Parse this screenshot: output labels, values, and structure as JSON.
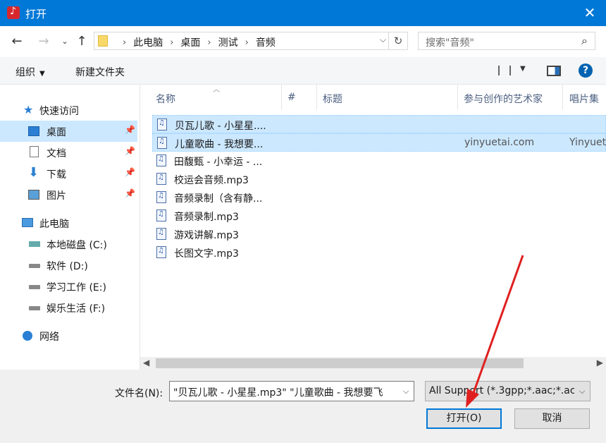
{
  "window": {
    "title": "打开"
  },
  "nav": {
    "breadcrumbs": [
      "此电脑",
      "桌面",
      "测试",
      "音频"
    ],
    "search_placeholder": "搜索\"音频\""
  },
  "toolbar": {
    "organize": "组织",
    "new_folder": "新建文件夹"
  },
  "sidebar": {
    "quick_access": "快速访问",
    "items": [
      {
        "label": "桌面",
        "icon": "desktop-icon"
      },
      {
        "label": "文档",
        "icon": "document-icon"
      },
      {
        "label": "下载",
        "icon": "download-icon"
      },
      {
        "label": "图片",
        "icon": "picture-icon"
      }
    ],
    "this_pc": "此电脑",
    "drives": [
      {
        "label": "本地磁盘 (C:)"
      },
      {
        "label": "软件 (D:)"
      },
      {
        "label": "学习工作 (E:)"
      },
      {
        "label": "娱乐生活 (F:)"
      }
    ],
    "network": "网络"
  },
  "columns": [
    "名称",
    "#",
    "标题",
    "参与创作的艺术家",
    "唱片集"
  ],
  "files": [
    {
      "name": "贝瓦儿歌 - 小星星....",
      "artist": "",
      "album": "",
      "selected": true
    },
    {
      "name": "儿童歌曲 - 我想要...",
      "artist": "yinyuetai.com",
      "album": "Yinyuet",
      "selected": true
    },
    {
      "name": "田馥甄 - 小幸运 - ...",
      "artist": "",
      "album": "",
      "selected": false
    },
    {
      "name": "校运会音频.mp3",
      "artist": "",
      "album": "",
      "selected": false
    },
    {
      "name": "音频录制（含有静...",
      "artist": "",
      "album": "",
      "selected": false
    },
    {
      "name": "音频录制.mp3",
      "artist": "",
      "album": "",
      "selected": false
    },
    {
      "name": "游戏讲解.mp3",
      "artist": "",
      "album": "",
      "selected": false
    },
    {
      "name": "长图文字.mp3",
      "artist": "",
      "album": "",
      "selected": false
    }
  ],
  "footer": {
    "filename_label": "文件名(N):",
    "filename_value": "\"贝瓦儿歌 - 小星星.mp3\" \"儿童歌曲 - 我想要飞",
    "filetype_value": "All Support (*.3gpp;*.aac;*.ac",
    "open_label": "打开(O)",
    "cancel_label": "取消"
  },
  "colors": {
    "accent": "#0078d7",
    "selection": "#cce8ff",
    "annotation_arrow": "#e02020"
  }
}
